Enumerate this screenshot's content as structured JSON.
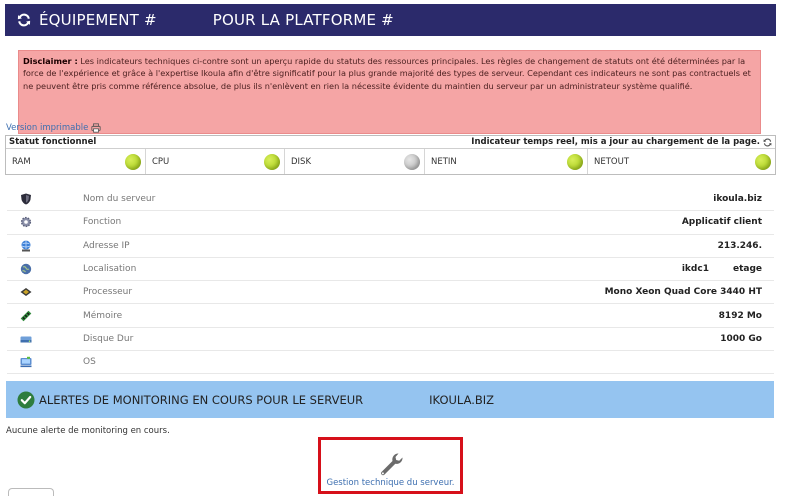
{
  "header": {
    "title_left": "ÉQUIPEMENT #",
    "title_right": "POUR LA PLATFORME #"
  },
  "disclaimer": {
    "label": "Disclaimer :",
    "text": " Les indicateurs techniques ci-contre sont un aperçu rapide du statuts des ressources principales. Les règles de changement de statuts ont été déterminées par la force de l'expérience et grâce à l'expertise Ikoula afin d'être significatif pour la plus grande majorité des types de serveur. Cependant ces indicateurs ne sont pas contractuels et ne peuvent être pris comme référence absolue, de plus ils n'enlèvent en rien la nécessite évidente du maintien du serveur par un administrateur système qualifié."
  },
  "print_link": "Version imprimable",
  "status": {
    "left_label": "Statut fonctionnel",
    "right_label": "Indicateur temps reel, mis a jour au chargement de la page.",
    "items": [
      {
        "label": "RAM",
        "state": "green"
      },
      {
        "label": "CPU",
        "state": "green"
      },
      {
        "label": "DISK",
        "state": "gray"
      },
      {
        "label": "NETIN",
        "state": "green"
      },
      {
        "label": "NETOUT",
        "state": "green"
      }
    ]
  },
  "server_info": [
    {
      "icon": "shield-icon",
      "label": "Nom du serveur",
      "value": "ikoula.biz"
    },
    {
      "icon": "gear-icon",
      "label": "Fonction",
      "value": "Applicatif client"
    },
    {
      "icon": "network-globe-icon",
      "label": "Adresse IP",
      "value": "213.246."
    },
    {
      "icon": "globe-icon",
      "label": "Localisation",
      "value": "ikdc1",
      "value2": "etage"
    },
    {
      "icon": "cpu-chip-icon",
      "label": "Processeur",
      "value": "Mono Xeon Quad Core 3440 HT"
    },
    {
      "icon": "memory-stick-icon",
      "label": "Mémoire",
      "value": "8192 Mo"
    },
    {
      "icon": "hard-disk-icon",
      "label": "Disque Dur",
      "value": "1000 Go"
    },
    {
      "icon": "os-icon",
      "label": "OS",
      "value": ""
    }
  ],
  "alerts": {
    "title": "ALERTES DE MONITORING EN COURS POUR LE SERVEUR",
    "server": "IKOULA.BIZ",
    "empty_message": "Aucune alerte de monitoring en cours."
  },
  "gestion": {
    "label": "Gestion technique du serveur."
  },
  "colors": {
    "header_bg": "#2b2a6b",
    "disclaimer_bg": "#f5a5a5",
    "status_ok": "#9bc40e",
    "status_unknown": "#aaaaaa",
    "alert_bar_bg": "#95c4f0",
    "highlight_border": "#d6101a",
    "link": "#3d6fb0"
  }
}
